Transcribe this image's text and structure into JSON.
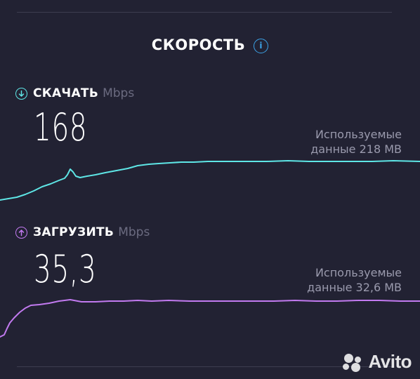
{
  "title": "СКОРОСТЬ",
  "info_icon": "info-icon",
  "download": {
    "label": "СКАЧАТЬ",
    "unit": "Mbps",
    "value": "168",
    "used_line1": "Используемые",
    "used_line2": "данные 218 MB",
    "icon": "arrow-down-circle-icon",
    "color": "#5ee6e6"
  },
  "upload": {
    "label": "ЗАГРУЗИТЬ",
    "unit": "Mbps",
    "value": "35,3",
    "used_line1": "Используемые",
    "used_line2": "данные 32,6 MB",
    "icon": "arrow-up-circle-icon",
    "color": "#c27af0"
  },
  "watermark": {
    "text": "Avito"
  },
  "colors": {
    "background": "#222233",
    "info_accent": "#3ca3e8"
  }
}
